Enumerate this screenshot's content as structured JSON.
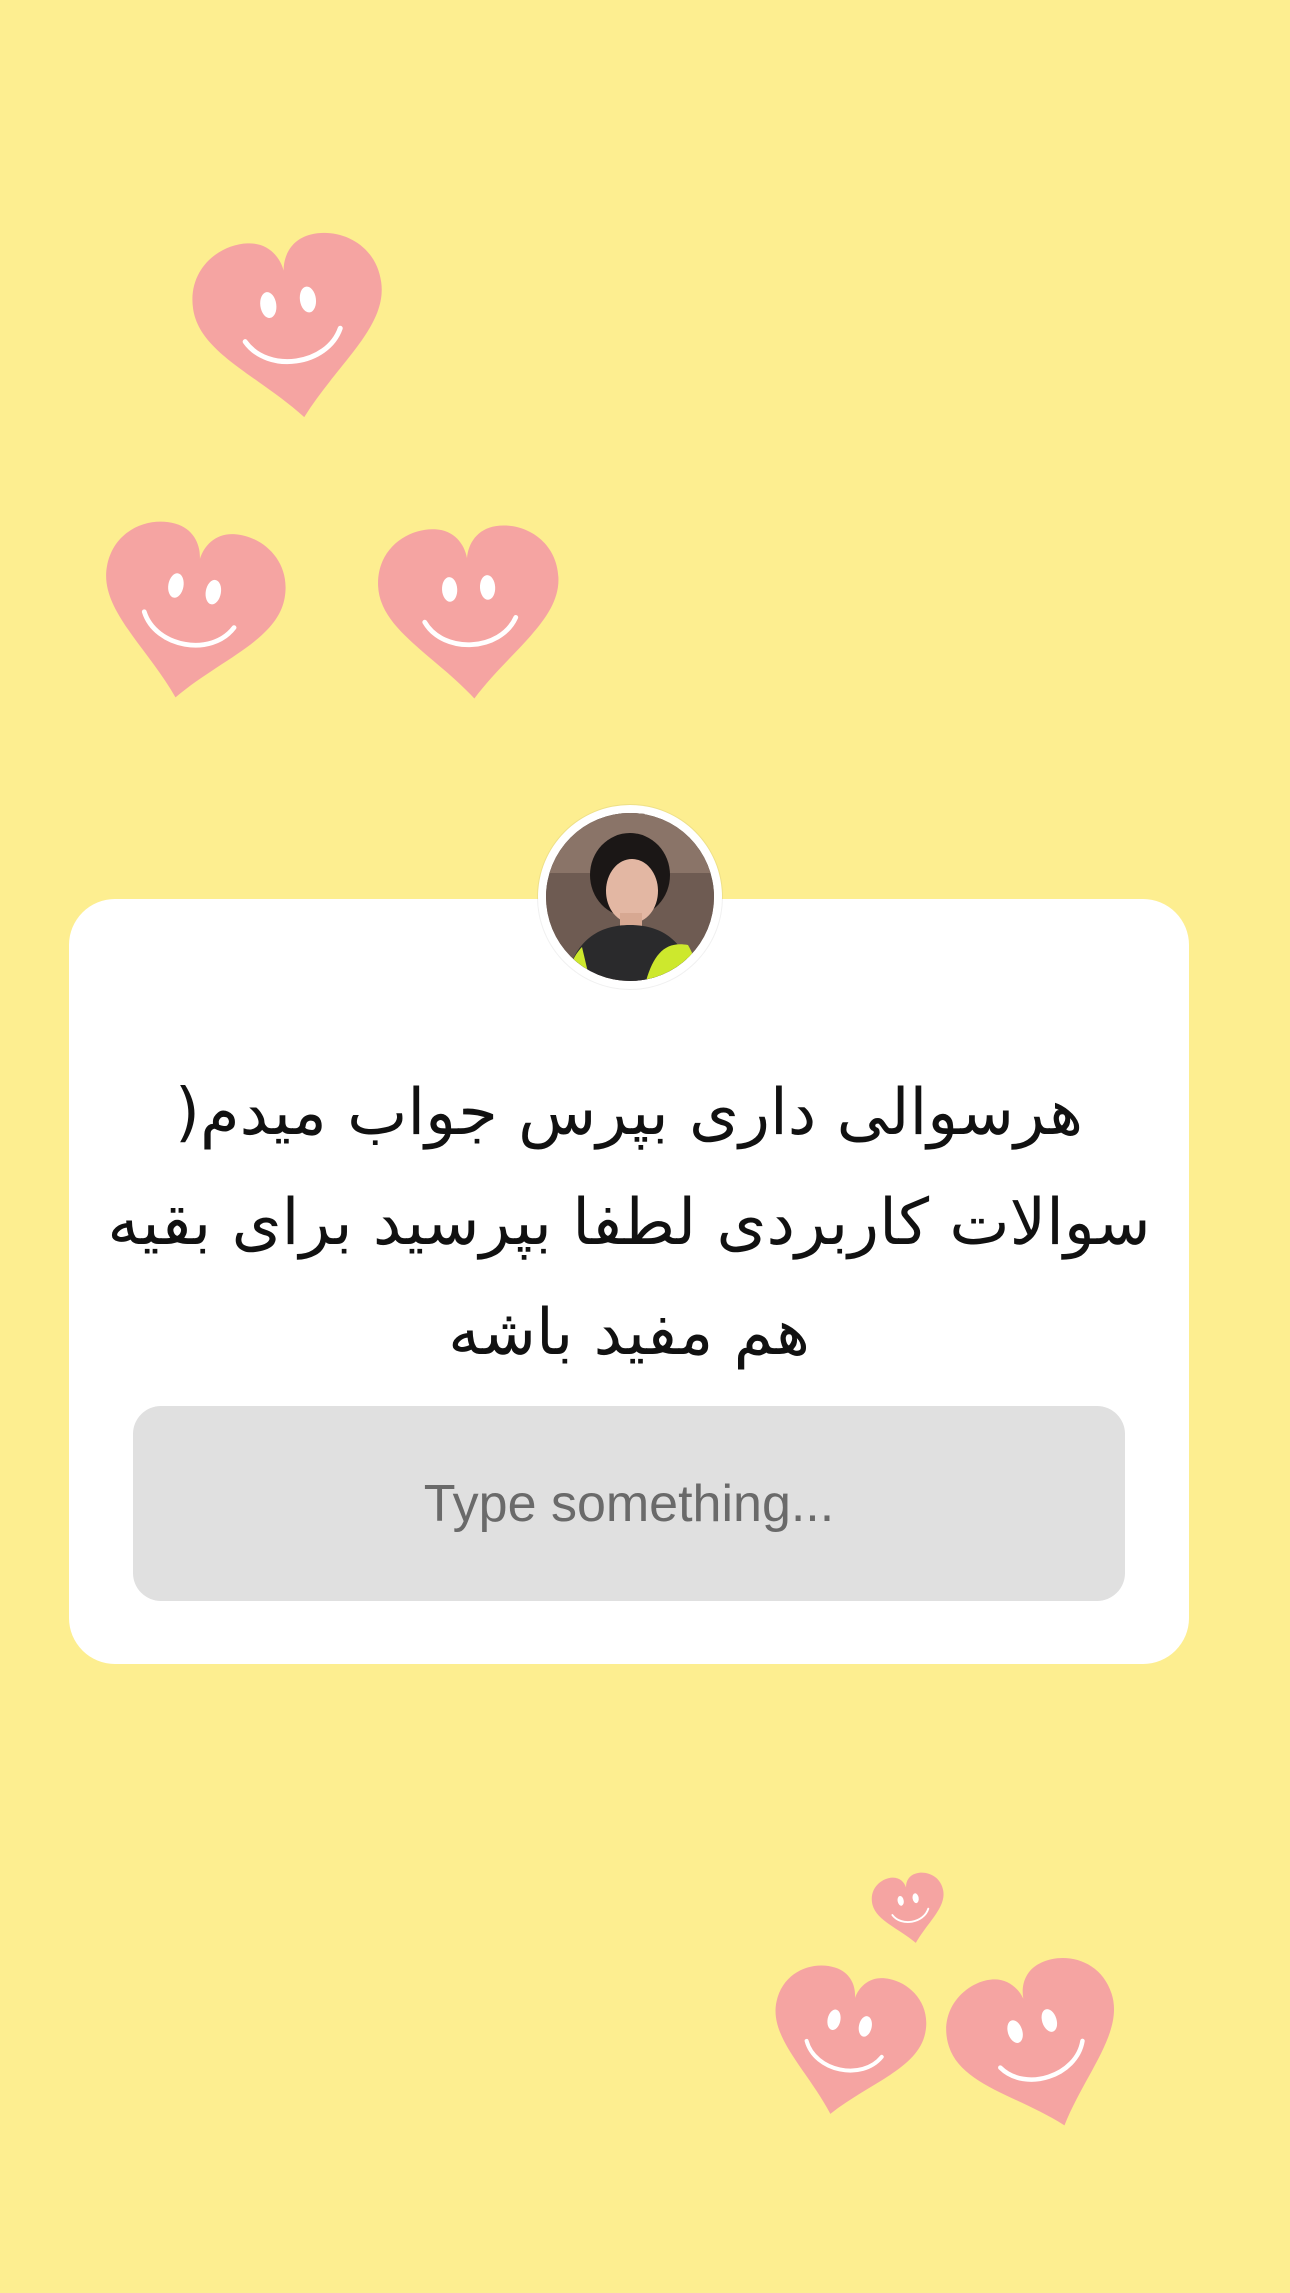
{
  "colors": {
    "background": "#fdee90",
    "heart": "#f5a4a2",
    "card": "#ffffff",
    "input_background": "#e0e0e0",
    "placeholder_text": "#6a6a6a"
  },
  "story": {
    "avatar_icon": "profile-photo",
    "question_text": "هرسوالی داری بپرس جواب میدم( سوالات کاربردی لطفا بپرسید برای بقیه هم مفید باشه",
    "answer_placeholder": "Type something..."
  },
  "decorations": {
    "icon": "smiling-heart-icon",
    "count": 6
  }
}
